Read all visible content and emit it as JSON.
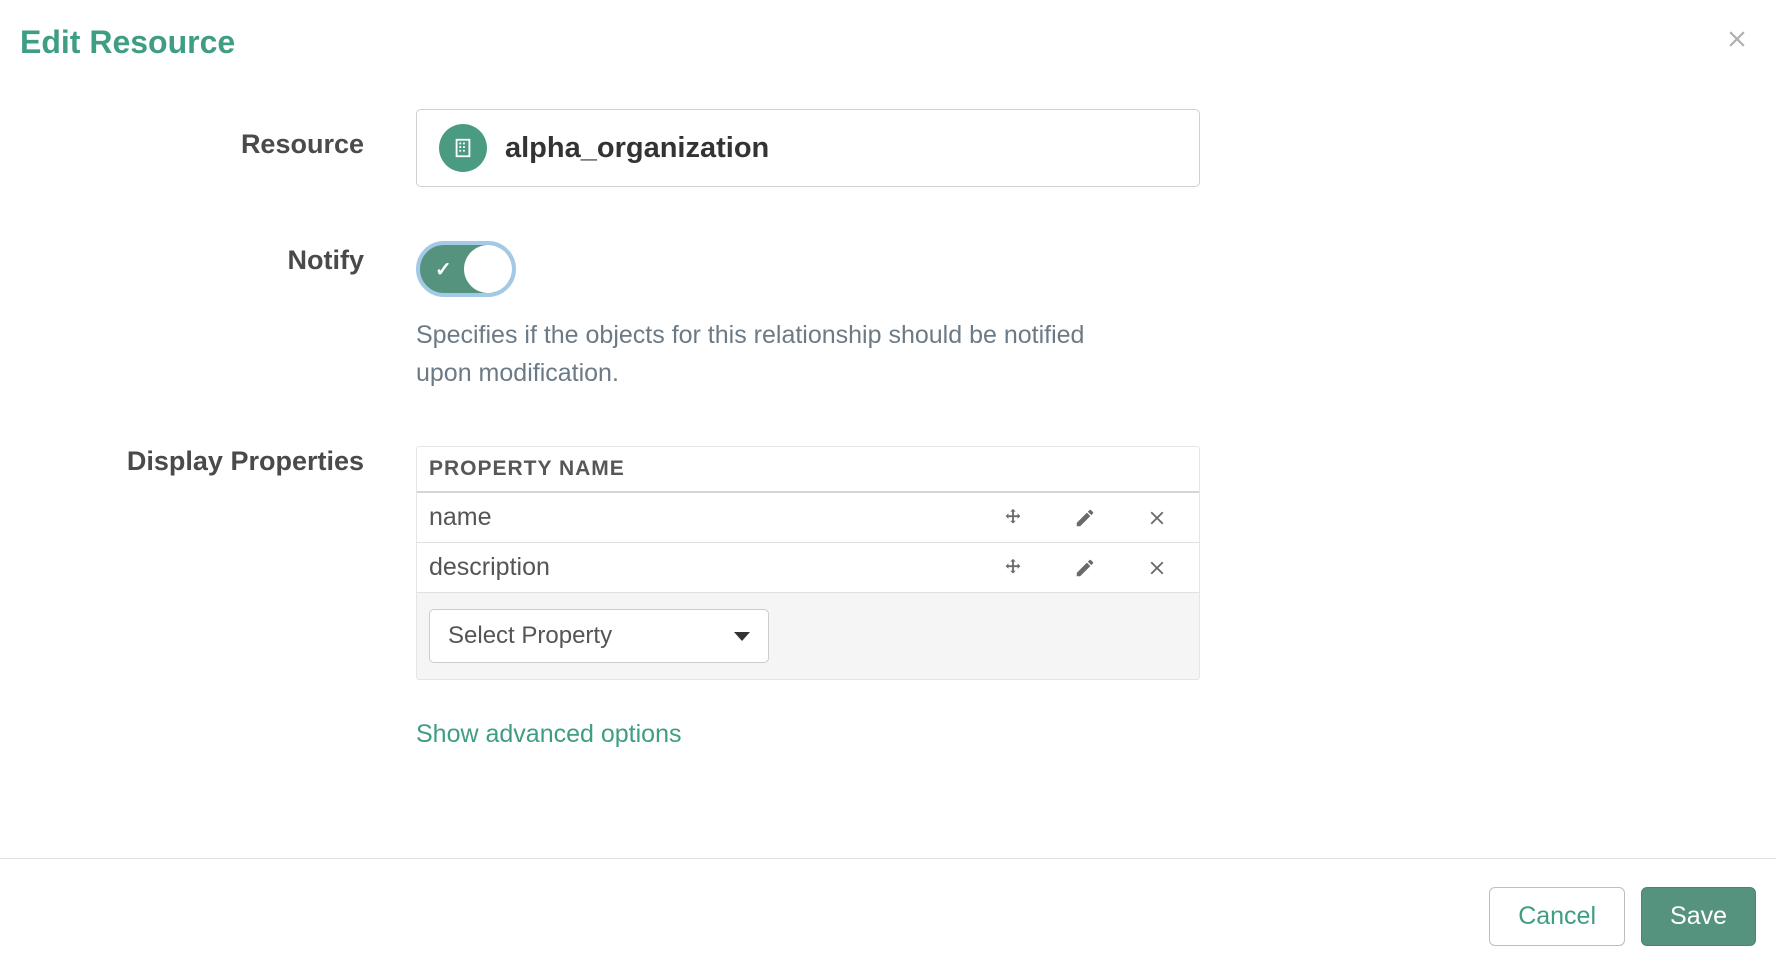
{
  "dialog": {
    "title": "Edit Resource"
  },
  "form": {
    "resource": {
      "label": "Resource",
      "value": "alpha_organization"
    },
    "notify": {
      "label": "Notify",
      "enabled": true,
      "help_text": "Specifies if the objects for this relationship should be notified upon modification."
    },
    "display_properties": {
      "label": "Display Properties",
      "column_header": "PROPERTY NAME",
      "rows": [
        {
          "name": "name"
        },
        {
          "name": "description"
        }
      ],
      "select_placeholder": "Select Property"
    },
    "advanced_link": "Show advanced options"
  },
  "footer": {
    "cancel_label": "Cancel",
    "save_label": "Save"
  }
}
